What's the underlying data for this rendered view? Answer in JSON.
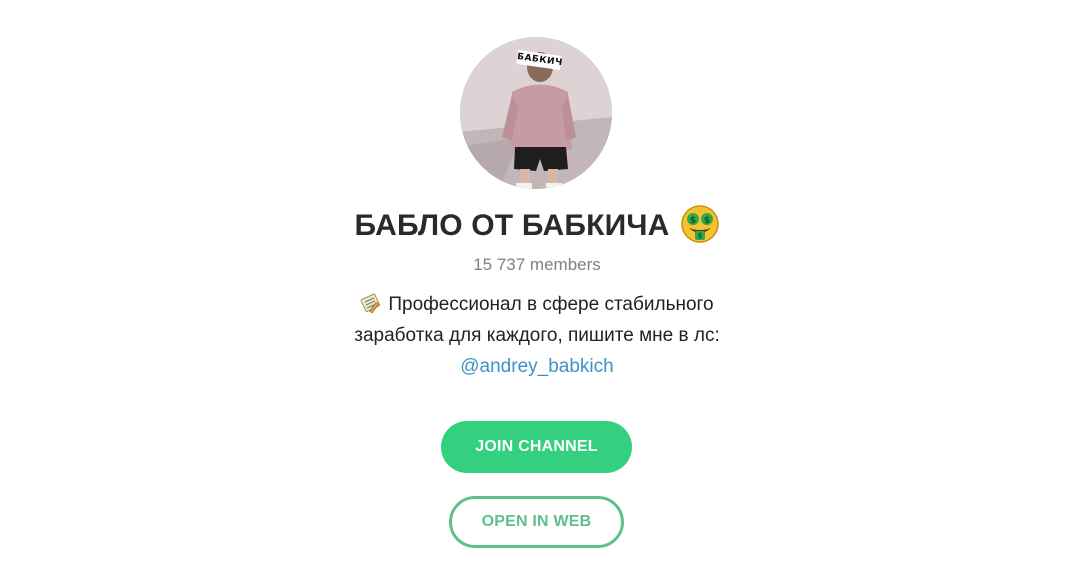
{
  "channel": {
    "avatar_caption": "БАБКИЧ",
    "title": "БАБЛО ОТ БАБКИЧА",
    "title_emoji": "money-mouth-face",
    "members": "15 737 members",
    "description_lines": [
      "Профессионал в сфере стабильного",
      "заработка для каждого, пишите мне в лс:"
    ],
    "description_icon": "memo-icon",
    "description_link": "@andrey_babkich"
  },
  "buttons": {
    "join": "JOIN CHANNEL",
    "open_web": "OPEN IN WEB"
  },
  "colors": {
    "accent_green": "#33d07f",
    "outline_green": "#5fc08e",
    "link_blue": "#3d93c7",
    "muted_text": "#808080",
    "title_text": "#2a2a2a"
  }
}
